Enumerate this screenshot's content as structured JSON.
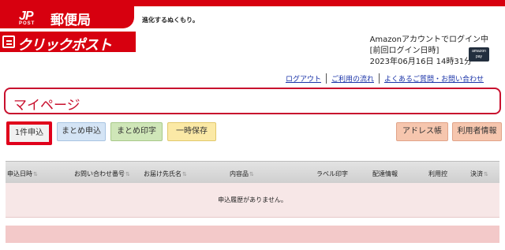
{
  "brand": {
    "mark": "JP",
    "post": "POST",
    "name": "郵便局",
    "tagline": "進化するぬくもり。",
    "service": "クリックポスト"
  },
  "login": {
    "line1": "Amazonアカウントでログイン中",
    "line2": "[前回ログイン日時]",
    "line3": "2023年06月16日 14時31分",
    "amazon_pay_top": "amazon",
    "amazon_pay_bottom": "pay"
  },
  "links": {
    "logout": "ログアウト",
    "usage": "ご利用の流れ",
    "faq": "よくあるご質問・お問い合わせ"
  },
  "page_title": "マイページ",
  "buttons": {
    "single": "1件申込",
    "bulk": "まとめ申込",
    "bulk_print": "まとめ印字",
    "temp_save": "一時保存",
    "address_book": "アドレス帳",
    "user_info": "利用者情報"
  },
  "table": {
    "columns": [
      "申込日時",
      "お問い合わせ番号",
      "お届け先氏名",
      "内容品",
      "ラベル印字",
      "配達情報",
      "利用控",
      "決済"
    ],
    "empty_message": "申込履歴がありません。"
  },
  "colors": {
    "brand_red": "#d7000f",
    "title_red": "#c8102e",
    "link_blue": "#1a33a8"
  }
}
